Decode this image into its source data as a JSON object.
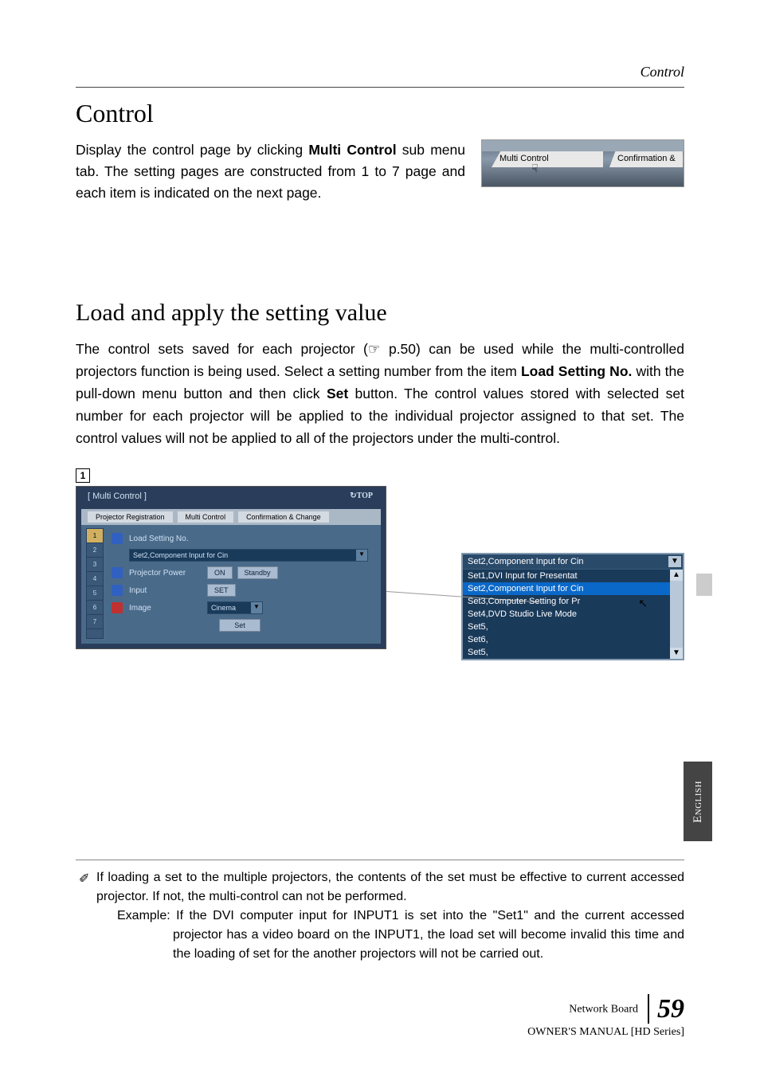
{
  "header": {
    "section": "Control"
  },
  "sections": {
    "title1": "Control",
    "intro": {
      "part1": "Display the control page by clicking ",
      "bold1": "Multi Control",
      "part2": " sub menu tab. The setting pages are constructed from 1 to 7 page and each item is indicated on the next page."
    },
    "tabimage": {
      "tab1": "Multi Control",
      "tab2": "Confirmation &"
    },
    "title2": "Load and apply the setting value",
    "body": {
      "p1a": "The control sets saved for each projector (☞ p.50) can be used while the multi-controlled projectors function is being used. Select a setting number from the item ",
      "b1": "Load Setting No.",
      "p1b": " with the pull-down menu button and then click ",
      "b2": "Set",
      "p1c": " button. The control values stored with selected set number for each projector will be applied to the individual projector assigned to that set. The control values will not be applied to all of the projectors under the multi-control."
    }
  },
  "screenshot": {
    "page_badge": "1",
    "window_title": "Multi Control",
    "top_icon": "↻TOP",
    "tabs": [
      "Projector Registration",
      "Multi Control",
      "Confirmation & Change"
    ],
    "nav": [
      "1",
      "2",
      "3",
      "4",
      "5",
      "6",
      "7"
    ],
    "fields": {
      "load_label": "Load Setting No.",
      "load_value": "Set2,Component Input for Cin",
      "power_label": "Projector Power",
      "power_on": "ON",
      "power_standby": "Standby",
      "input_label": "Input",
      "input_btn": "SET",
      "image_label": "Image",
      "image_val": "Cinema",
      "set_btn": "Set"
    }
  },
  "dropdown": {
    "selected_top": "Set2,Component Input for Cin",
    "items": [
      "Set1,DVI Input for Presentat",
      "Set2,Component Input for Cin",
      "Set3,Computer Setting for Pr",
      "Set4,DVD Studio Live Mode",
      "Set5,",
      "Set6,",
      "Set5,"
    ]
  },
  "english_tab": "English",
  "footnote": {
    "line1": "If loading a set to the multiple projectors, the contents of the set must be effective to current accessed projector. If not, the multi-control  can not be performed.",
    "example_label": "Example:",
    "example_text": "If the DVI computer input for INPUT1 is set into the \"Set1\" and the current accessed projector has a video board on the INPUT1, the load set will become invalid this time and the loading of set for the another projectors will not be carried out."
  },
  "footer": {
    "line1": "Network Board",
    "line2": "OWNER'S MANUAL [HD Series]",
    "page": "59"
  }
}
